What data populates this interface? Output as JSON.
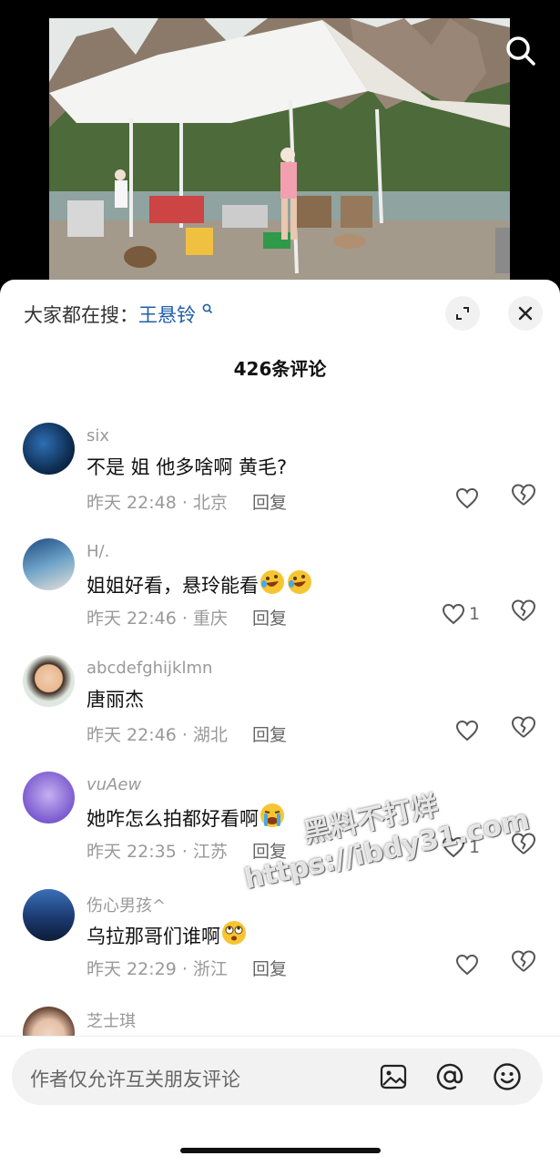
{
  "hot_search": {
    "prefix": "大家都在搜：",
    "keyword": "王悬铃"
  },
  "comment_count": "426条评论",
  "comments": [
    {
      "name": "six",
      "text": "不是 姐 他多啥啊 黄毛?",
      "meta": "昨天 22:48 · 北京",
      "reply": "回复",
      "likes": ""
    },
    {
      "name": "H/.",
      "text": "姐姐好看，悬玲能看",
      "emoji": "rofl-emoji",
      "emoji_count": 2,
      "meta": "昨天 22:46 · 重庆",
      "reply": "回复",
      "likes": "1"
    },
    {
      "name": "abcdefghijklmn",
      "text": "唐丽杰",
      "meta": "昨天 22:46 · 湖北",
      "reply": "回复",
      "likes": ""
    },
    {
      "name": "vuAew",
      "text": "她咋怎么拍都好看啊",
      "emoji": "crying-emoji",
      "emoji_count": 1,
      "meta": "昨天 22:35 · 江苏",
      "reply": "回复",
      "likes": "1"
    },
    {
      "name": "伤心男孩^",
      "text": "乌拉那哥们谁啊",
      "emoji": "rolling-eyes-emoji",
      "emoji_count": 1,
      "meta": "昨天 22:29 · 浙江",
      "reply": "回复",
      "likes": ""
    },
    {
      "name": "芝士琪",
      "text": "",
      "meta": "",
      "reply": "",
      "likes": ""
    }
  ],
  "input": {
    "placeholder": "作者仅允许互关朋友评论"
  },
  "watermark": {
    "line1": "黑料不打烊",
    "line2": "https://ibdy31.com"
  },
  "colors": {
    "keyword": "#1f5fa8",
    "meta": "#999999",
    "sheet_bg": "#ffffff",
    "input_bg": "#f2f2f2"
  },
  "icons": [
    "search-icon",
    "expand-icon",
    "close-icon",
    "heart-icon",
    "broken-heart-icon",
    "image-icon",
    "at-icon",
    "emoji-icon"
  ]
}
